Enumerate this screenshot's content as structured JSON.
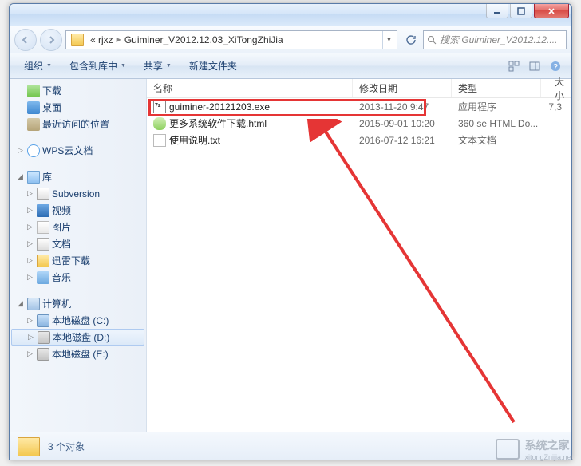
{
  "breadcrumb": {
    "seg1": "«  rjxz",
    "seg2": "Guiminer_V2012.12.03_XiTongZhiJia"
  },
  "search": {
    "placeholder": "搜索 Guiminer_V2012.12...."
  },
  "toolbar": {
    "org": "组织",
    "include": "包含到库中",
    "share": "共享",
    "newfolder": "新建文件夹"
  },
  "columns": {
    "name": "名称",
    "date": "修改日期",
    "type": "类型",
    "size": "大小"
  },
  "sidebar": {
    "downloads": "下载",
    "desktop": "桌面",
    "recent": "最近访问的位置",
    "wps": "WPS云文档",
    "lib": "库",
    "svn": "Subversion",
    "video": "视频",
    "pic": "图片",
    "doc": "文档",
    "thunder": "迅雷下载",
    "music": "音乐",
    "computer": "计算机",
    "drive_c": "本地磁盘 (C:)",
    "drive_d": "本地磁盘 (D:)",
    "drive_e": "本地磁盘 (E:)"
  },
  "files": [
    {
      "name": "guiminer-20121203.exe",
      "date": "2013-11-20 9:47",
      "type": "应用程序",
      "size": "7,3",
      "icon": "exe"
    },
    {
      "name": "更多系统软件下载.html",
      "date": "2015-09-01 10:20",
      "type": "360 se HTML Do...",
      "size": "",
      "icon": "html"
    },
    {
      "name": "使用说明.txt",
      "date": "2016-07-12 16:21",
      "type": "文本文档",
      "size": "",
      "icon": "txt"
    }
  ],
  "status": {
    "count": "3 个对象"
  },
  "watermark": {
    "text": "系统之家",
    "sub": "xitongZnijia.net"
  }
}
